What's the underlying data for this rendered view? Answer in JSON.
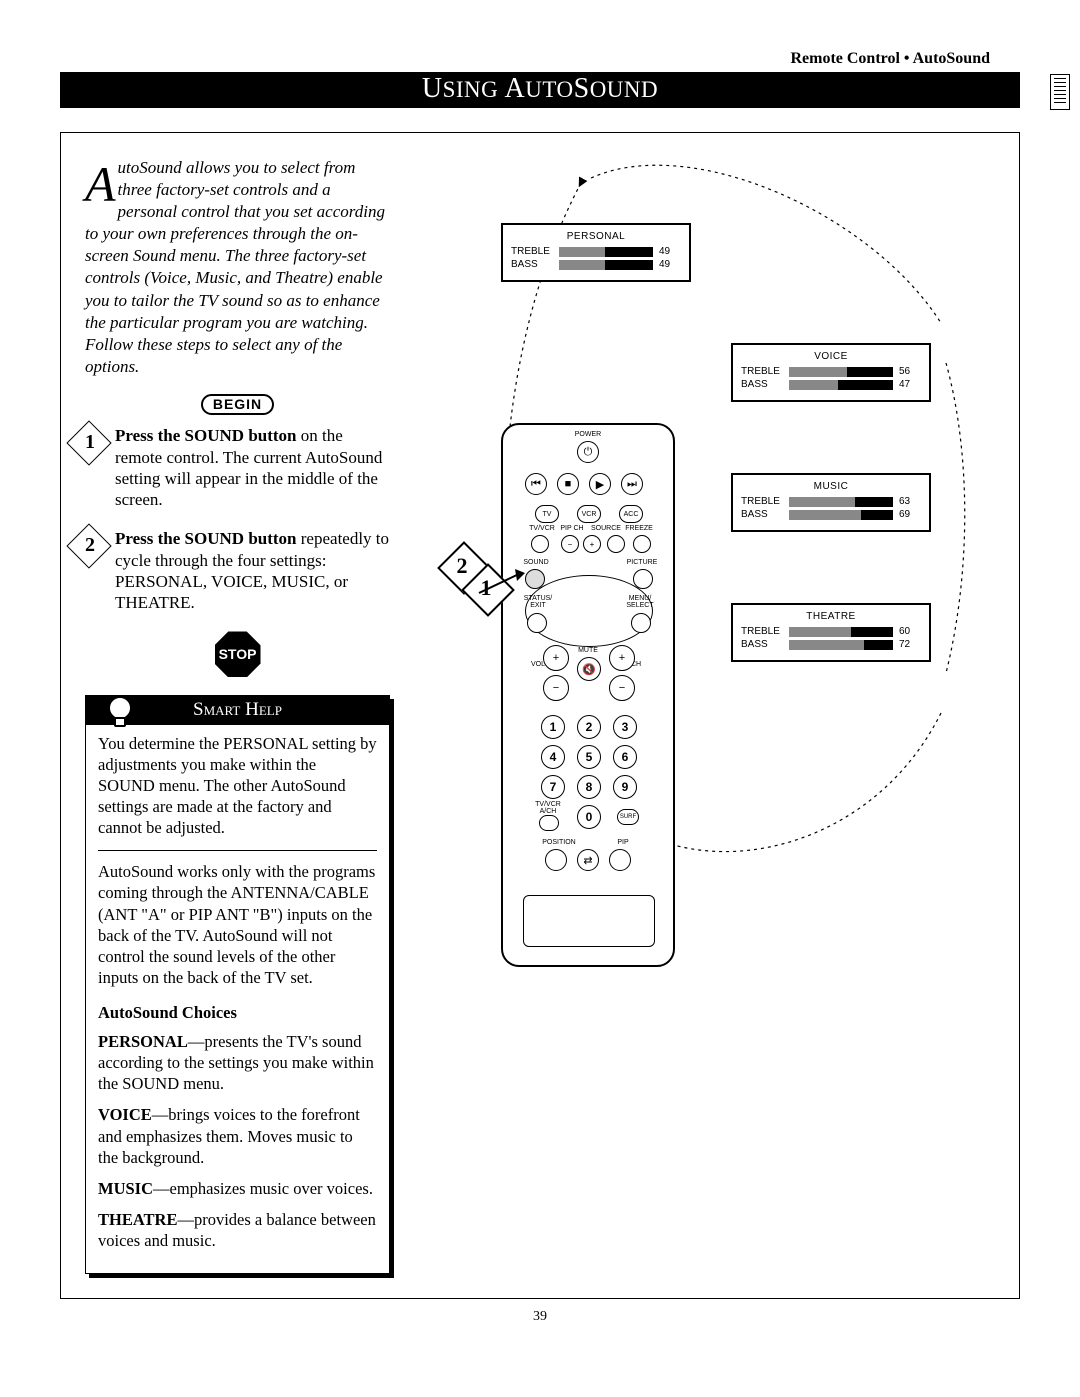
{
  "header": {
    "breadcrumb": "Remote Control • AutoSound",
    "title_pre": "U",
    "title_mid1": "SING ",
    "title_A": "A",
    "title_mid2": "UTO",
    "title_S": "S",
    "title_end": "OUND"
  },
  "intro": {
    "dropcap": "A",
    "text": "utoSound allows you to select from three factory-set controls and a personal control that you set according to your own preferences through the on-screen Sound menu. The three factory-set controls (Voice, Music, and Theatre) enable you to tailor the TV sound so as to enhance the particular program you are watching. Follow these steps to select any of the options."
  },
  "begin_label": "BEGIN",
  "steps": [
    {
      "num": "1",
      "bold": "Press the SOUND button",
      "rest": " on the remote control. The current AutoSound setting will appear in the middle of the screen."
    },
    {
      "num": "2",
      "bold": "Press the SOUND button",
      "rest": " repeatedly to cycle through the four settings: PERSONAL, VOICE, MUSIC, or THEATRE."
    }
  ],
  "stop_label": "STOP",
  "smart_help": {
    "heading": "Smart Help",
    "p1": "You determine the PERSONAL setting by adjustments you make within the SOUND menu. The other AutoSound settings are made at the factory and cannot be adjusted.",
    "p2": "AutoSound works only with the programs coming through the ANTENNA/CABLE (ANT \"A\" or PIP ANT \"B\") inputs on the back of the TV. AutoSound will not control the sound levels of the other inputs on the back of the TV set."
  },
  "choices": {
    "heading": "AutoSound Choices",
    "items": [
      {
        "name": "PERSONAL",
        "desc": "—presents the TV's sound according to the settings you make within the SOUND menu."
      },
      {
        "name": "VOICE",
        "desc": "—brings voices to the forefront and emphasizes them. Moves music to the background."
      },
      {
        "name": "MUSIC",
        "desc": "—emphasizes music over voices."
      },
      {
        "name": "THEATRE",
        "desc": "—provides a balance between voices and music."
      }
    ]
  },
  "osd": {
    "personal": {
      "title": "PERSONAL",
      "treble": 49,
      "bass": 49
    },
    "voice": {
      "title": "VOICE",
      "treble": 56,
      "bass": 47
    },
    "music": {
      "title": "MUSIC",
      "treble": 63,
      "bass": 69
    },
    "theatre": {
      "title": "THEATRE",
      "treble": 60,
      "bass": 72
    },
    "labels": {
      "treble": "TREBLE",
      "bass": "BASS"
    }
  },
  "remote": {
    "power": "POWER",
    "tv": "TV",
    "vcr": "VCR",
    "acc": "ACC",
    "tvvcr": "TV/VCR",
    "pipch": "PIP CH",
    "source": "SOURCE",
    "freeze": "FREEZE",
    "sound": "SOUND",
    "picture": "PICTURE",
    "status": "STATUS/\nEXIT",
    "menu": "MENU/\nSELECT",
    "vol": "VOL",
    "ch": "CH",
    "mute": "MUTE",
    "position": "POSITION",
    "pip": "PIP",
    "ach": "TV/VCR\nA/CH",
    "surf": "SURF",
    "digits": [
      "1",
      "2",
      "3",
      "4",
      "5",
      "6",
      "7",
      "8",
      "9",
      "0"
    ]
  },
  "callouts": {
    "one": "1",
    "two": "2"
  },
  "page_number": "39"
}
